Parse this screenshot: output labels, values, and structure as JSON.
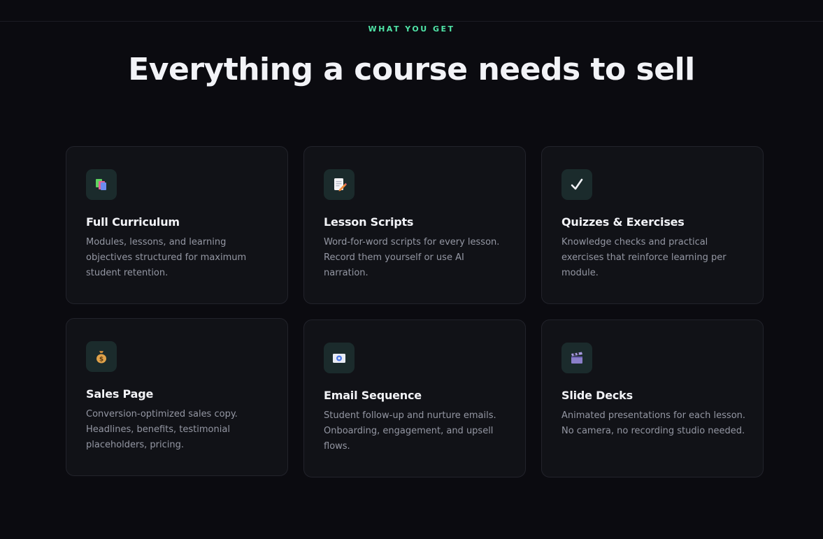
{
  "section": {
    "eyebrow": "WHAT YOU GET",
    "title": "Everything a course needs to sell"
  },
  "features": [
    {
      "icon": "books-icon",
      "title": "Full Curriculum",
      "description": "Modules, lessons, and learning objectives structured for maximum student retention."
    },
    {
      "icon": "memo-pencil-icon",
      "title": "Lesson Scripts",
      "description": "Word-for-word scripts for every lesson. Record them yourself or use AI narration."
    },
    {
      "icon": "checkmark-icon",
      "title": "Quizzes & Exercises",
      "description": "Knowledge checks and practical exercises that reinforce learning per module."
    },
    {
      "icon": "money-bag-icon",
      "title": "Sales Page",
      "description": "Conversion-optimized sales copy. Headlines, benefits, testimonial placeholders, pricing."
    },
    {
      "icon": "email-icon",
      "title": "Email Sequence",
      "description": "Student follow-up and nurture emails. Onboarding, engagement, and upsell flows."
    },
    {
      "icon": "clapper-board-icon",
      "title": "Slide Decks",
      "description": "Animated presentations for each lesson. No camera, no recording studio needed."
    }
  ],
  "colors": {
    "background": "#0b0b10",
    "card": "#111217",
    "accent": "#4fe3a6",
    "icon_tile": "#1b2b2c"
  }
}
